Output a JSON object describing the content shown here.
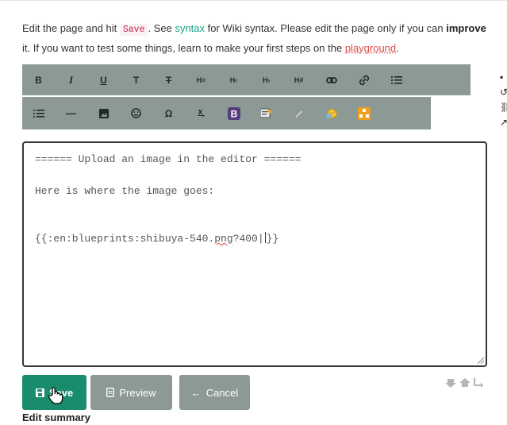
{
  "intro": {
    "t1": "Edit the page and hit ",
    "save_code": "Save",
    "t2": ". See ",
    "syntax_link": "syntax",
    "t3": " for Wiki syntax. Please edit the page only if you can ",
    "improve": "improve",
    "t4": " it. If you want to test some things, learn to make your first steps on the ",
    "playground_link": "playground",
    "t5": "."
  },
  "toolbar": {
    "row1": [
      {
        "name": "bold-button",
        "glyph": "B"
      },
      {
        "name": "italic-button",
        "glyph": "I"
      },
      {
        "name": "underline-button",
        "glyph": "U"
      },
      {
        "name": "code-button",
        "glyph": "T"
      },
      {
        "name": "strikethrough-button",
        "glyph": "T"
      },
      {
        "name": "heading-same-button",
        "glyph": "H="
      },
      {
        "name": "heading-higher-button",
        "glyph": "H‹"
      },
      {
        "name": "heading-lower-button",
        "glyph": "H›"
      },
      {
        "name": "heading-select-button",
        "glyph": "H#"
      },
      {
        "name": "internal-link-button",
        "glyph": "∞"
      },
      {
        "name": "external-link-button",
        "glyph": "link"
      },
      {
        "name": "ordered-list-button",
        "glyph": "ol"
      }
    ],
    "row2": [
      {
        "name": "unordered-list-button",
        "glyph": "ul"
      },
      {
        "name": "horizontal-rule-button",
        "glyph": "—"
      },
      {
        "name": "media-button",
        "glyph": "img"
      },
      {
        "name": "smiley-button",
        "glyph": "☺"
      },
      {
        "name": "special-chars-button",
        "glyph": "Ω"
      },
      {
        "name": "subscript-button",
        "glyph": "x"
      },
      {
        "name": "bootstrap-button",
        "glyph": "B"
      },
      {
        "name": "template-button",
        "glyph": "tpl"
      },
      {
        "name": "pencil-button",
        "glyph": "pen"
      },
      {
        "name": "box-button",
        "glyph": "box"
      },
      {
        "name": "plugin-button",
        "glyph": "plg"
      }
    ]
  },
  "editor": {
    "line1": "====== Upload an image in the editor ======",
    "line2": "Here is where the image goes:",
    "line3_a": "{{:en:blueprints:shibuya-540.",
    "line3_b": "png",
    "line3_c": "?400|",
    "line3_d": "}}"
  },
  "buttons": {
    "save": "Save",
    "preview": "Preview",
    "cancel": "Cancel"
  },
  "edit_summary_label": "Edit summary",
  "colors": {
    "accent": "#1a8c6e",
    "toolbar": "#8c9995",
    "link": "#1aa38a",
    "missing_link": "#e04b4b"
  }
}
